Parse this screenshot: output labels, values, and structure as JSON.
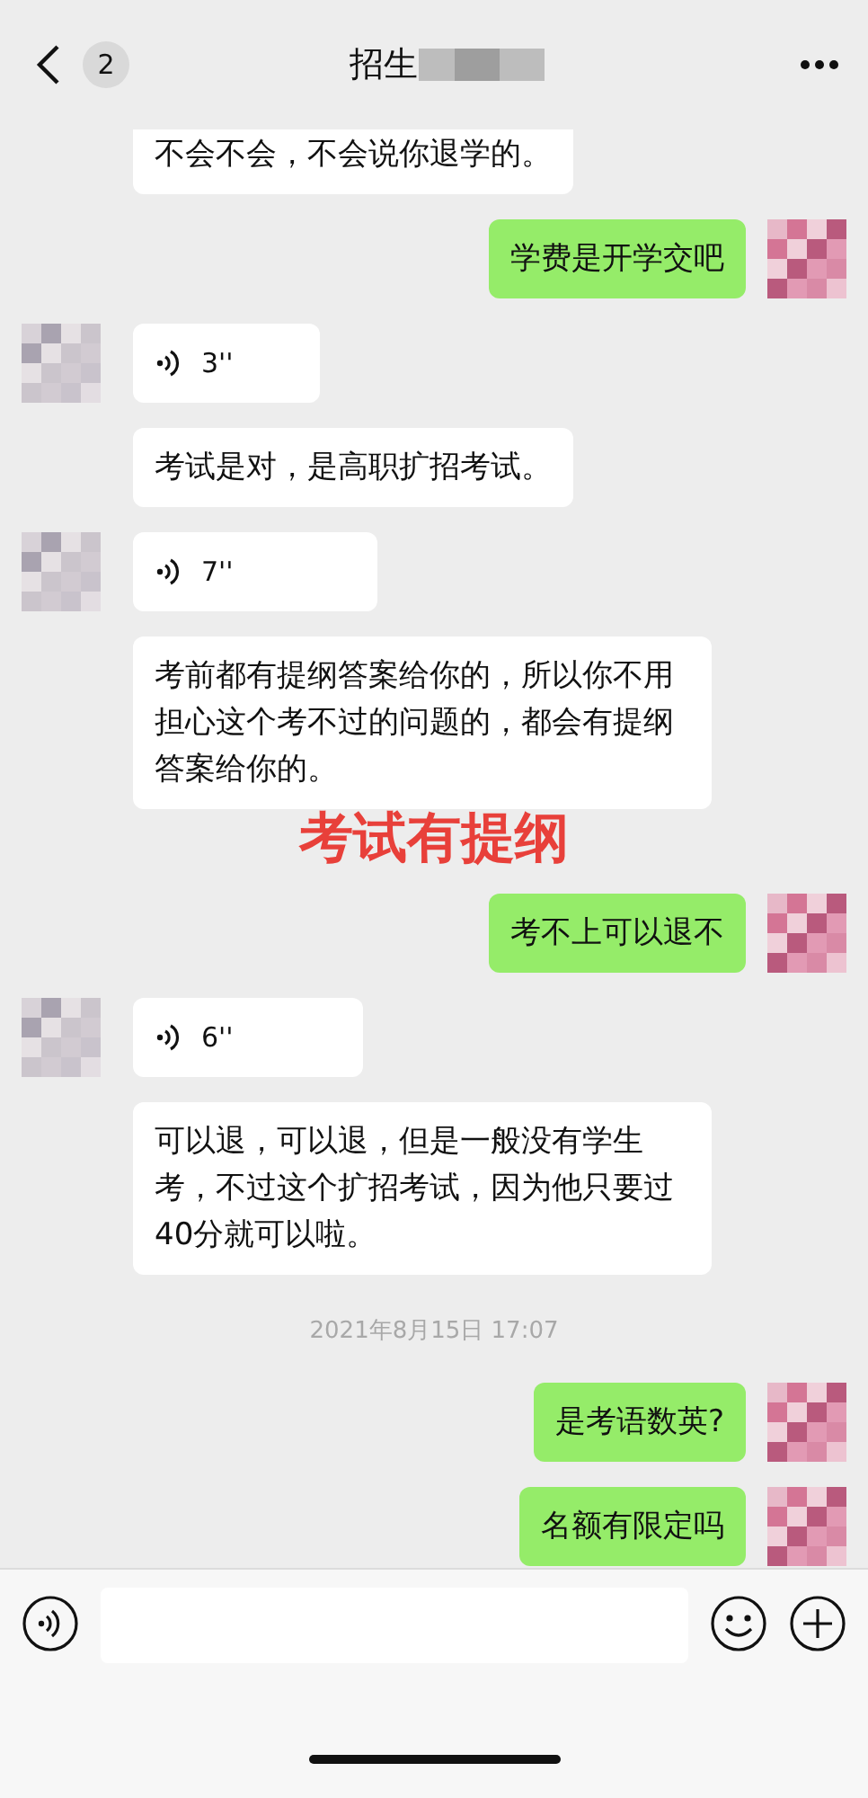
{
  "header": {
    "back_count": "2",
    "title": "招生"
  },
  "messages": [
    {
      "kind": "text",
      "outgoing": false,
      "text": "不会不会，不会说你退学的。",
      "avatar": false
    },
    {
      "kind": "text",
      "outgoing": true,
      "text": "学费是开学交吧",
      "avatar": true
    },
    {
      "kind": "voice",
      "outgoing": false,
      "text": "3''",
      "avatar": true
    },
    {
      "kind": "text",
      "outgoing": false,
      "text": "考试是对，是高职扩招考试。",
      "avatar": false
    },
    {
      "kind": "voice",
      "outgoing": false,
      "text": "7''",
      "avatar": true
    },
    {
      "kind": "text",
      "outgoing": false,
      "text": "考前都有提纲答案给你的，所以你不用担心这个考不过的问题的，都会有提纲答案给你的。",
      "avatar": false
    },
    {
      "kind": "annotation",
      "text": "考试有提纲"
    },
    {
      "kind": "text",
      "outgoing": true,
      "text": "考不上可以退不",
      "avatar": true
    },
    {
      "kind": "voice",
      "outgoing": false,
      "text": "6''",
      "avatar": true
    },
    {
      "kind": "text",
      "outgoing": false,
      "text": "可以退，可以退，但是一般没有学生考，不过这个扩招考试，因为他只要过40分就可以啦。",
      "avatar": false
    },
    {
      "kind": "timestamp",
      "text": "2021年8月15日 17:07"
    },
    {
      "kind": "text",
      "outgoing": true,
      "text": "是考语数英?",
      "avatar": true
    },
    {
      "kind": "text",
      "outgoing": true,
      "text": "名额有限定吗",
      "avatar": true
    }
  ]
}
